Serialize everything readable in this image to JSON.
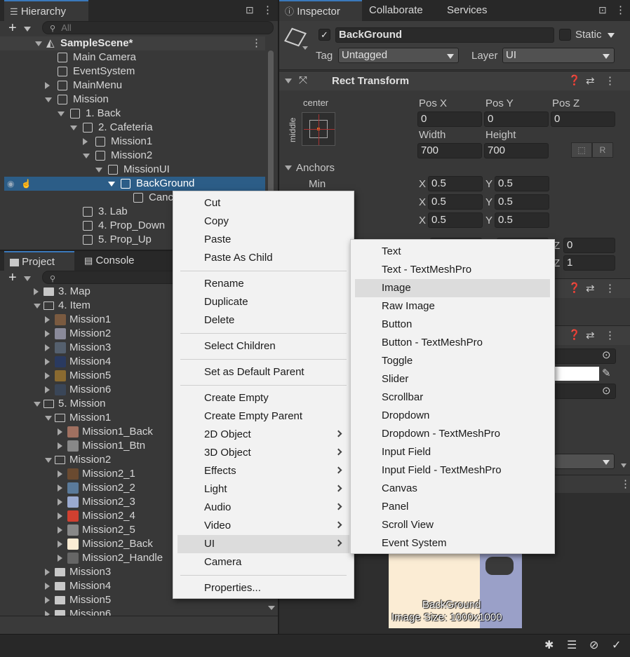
{
  "hierarchy": {
    "tab": "Hierarchy",
    "search_placeholder": "All",
    "scene": "SampleScene*",
    "rows": [
      {
        "label": "Main Camera"
      },
      {
        "label": "EventSystem"
      },
      {
        "label": "MainMenu"
      },
      {
        "label": "Mission"
      },
      {
        "label": "1. Back"
      },
      {
        "label": "2. Cafeteria"
      },
      {
        "label": "Mission1"
      },
      {
        "label": "Mission2"
      },
      {
        "label": "MissionUI"
      },
      {
        "label": "BackGround"
      },
      {
        "label": "Canc"
      },
      {
        "label": "3. Lab"
      },
      {
        "label": "4. Prop_Down"
      },
      {
        "label": "5. Prop_Up"
      }
    ]
  },
  "project": {
    "tab_project": "Project",
    "tab_console": "Console",
    "rows": [
      {
        "label": "3. Map"
      },
      {
        "label": "4. Item"
      },
      {
        "label": "Mission1"
      },
      {
        "label": "Mission2"
      },
      {
        "label": "Mission3"
      },
      {
        "label": "Mission4"
      },
      {
        "label": "Mission5"
      },
      {
        "label": "Mission6"
      },
      {
        "label": "5. Mission"
      },
      {
        "label": "Mission1"
      },
      {
        "label": "Mission1_Back"
      },
      {
        "label": "Mission1_Btn"
      },
      {
        "label": "Mission2"
      },
      {
        "label": "Mission2_1"
      },
      {
        "label": "Mission2_2"
      },
      {
        "label": "Mission2_3"
      },
      {
        "label": "Mission2_4"
      },
      {
        "label": "Mission2_5"
      },
      {
        "label": "Mission2_Back"
      },
      {
        "label": "Mission2_Handle"
      },
      {
        "label": "Mission3"
      },
      {
        "label": "Mission4"
      },
      {
        "label": "Mission5"
      },
      {
        "label": "Mission6"
      }
    ]
  },
  "inspector": {
    "tabs": [
      "Inspector",
      "Collaborate",
      "Services"
    ],
    "object_name": "BackGround",
    "static_label": "Static",
    "tag_label": "Tag",
    "tag_value": "Untagged",
    "layer_label": "Layer",
    "layer_value": "UI",
    "rect_transform": "Rect Transform",
    "anchor_top": "center",
    "anchor_side": "middle",
    "pos_x_label": "Pos X",
    "pos_x": "0",
    "pos_y_label": "Pos Y",
    "pos_y": "0",
    "pos_z_label": "Pos Z",
    "pos_z": "0",
    "width_label": "Width",
    "width": "700",
    "height_label": "Height",
    "height": "700",
    "anchors_label": "Anchors",
    "min_label": "Min",
    "x_label": "X",
    "y_label": "Y",
    "z_label": "Z",
    "anchor_rows": [
      {
        "x": "0.5",
        "y": "0.5"
      },
      {
        "x": "0.5",
        "y": "0.5"
      },
      {
        "x": "0.5",
        "y": "0.5"
      }
    ],
    "rot_z": "0",
    "scale_z": "1",
    "preview_name": "BackGround",
    "preview_size": "Image Size: 1000x1000"
  },
  "context_menu": {
    "groups": [
      [
        "Cut",
        "Copy",
        "Paste",
        "Paste As Child"
      ],
      [
        "Rename",
        "Duplicate",
        "Delete"
      ],
      [
        "Select Children"
      ],
      [
        "Set as Default Parent"
      ],
      [
        "Create Empty",
        "Create Empty Parent",
        "2D Object",
        "3D Object",
        "Effects",
        "Light",
        "Audio",
        "Video",
        "UI",
        "Camera"
      ],
      [
        "Properties..."
      ]
    ]
  },
  "ui_submenu": {
    "items": [
      "Text",
      "Text - TextMeshPro",
      "Image",
      "Raw Image",
      "Button",
      "Button - TextMeshPro",
      "Toggle",
      "Slider",
      "Scrollbar",
      "Dropdown",
      "Dropdown - TextMeshPro",
      "Input Field",
      "Input Field - TextMeshPro",
      "Canvas",
      "Panel",
      "Scroll View",
      "Event System"
    ],
    "highlighted": "Image"
  },
  "colors": {
    "selection": "#2c5d87",
    "menu_bg": "#f2f2f2",
    "accent": "#3a79bb"
  }
}
